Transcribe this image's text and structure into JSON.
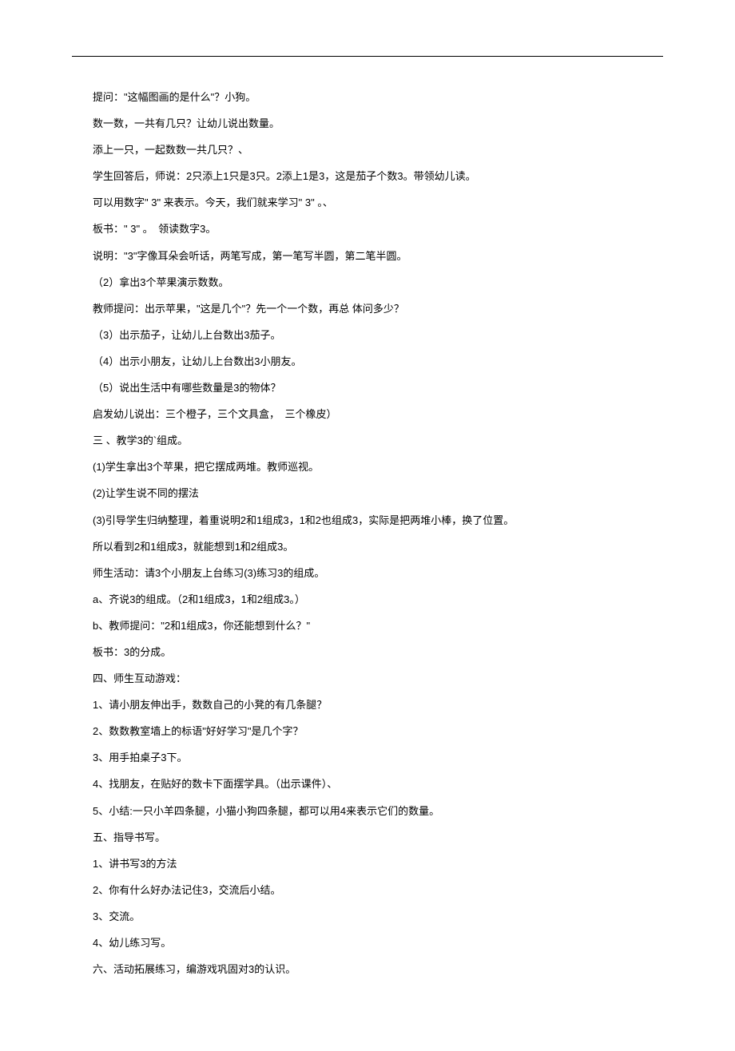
{
  "lines": [
    "提问：\"这幅图画的是什么\"？小狗。",
    "数一数，一共有几只？让幼儿说出数量。",
    "添上一只，一起数数一共几只？、",
    "学生回答后，师说：2只添上1只是3只。2添上1是3，这是茄子个数3。带领幼儿读。",
    "可以用数字\" 3\" 来表示。今天，我们就来学习\" 3\" 。、",
    "板书：\" 3\" 。　领读数字3。",
    "说明：\"3\"字像耳朵会听话，两笔写成，第一笔写半圆，第二笔半圆。",
    "（2）拿出3个苹果演示数数。",
    "教师提问：出示苹果，\"这是几个\"？先一个一个数，再总 体问多少？",
    "（3）出示茄子，让幼儿上台数出3茄子。",
    "（4）出示小朋友，让幼儿上台数出3小朋友。",
    "（5）说出生活中有哪些数量是3的物体？",
    "启发幼儿说出：三个橙子，三个文具盒，　三个橡皮）",
    "三 、教学3的`组成。",
    "(1)学生拿出3个苹果，把它摆成两堆。教师巡视。",
    "(2)让学生说不同的摆法",
    "(3)引导学生归纳整理，着重说明2和1组成3，1和2也组成3，实际是把两堆小棒，换了位置。",
    "所以看到2和1组成3，就能想到1和2组成3。",
    "师生活动：请3个小朋友上台练习(3)练习3的组成。",
    "a、齐说3的组成。（2和1组成3，1和2组成3。）",
    "b、教师提问：\"2和1组成3，你还能想到什么？\"",
    "板书：3的分成。",
    "四、师生互动游戏：",
    "1、请小朋友伸出手，数数自己的小凳的有几条腿？",
    "2、数数教室墙上的标语\"好好学习\"是几个字？",
    "3、用手拍桌子3下。",
    "4、找朋友，在贴好的数卡下面摆学具。（出示课件）、",
    "5、小结:一只小羊四条腿，小猫小狗四条腿，都可以用4来表示它们的数量。",
    "五、指导书写。",
    "1、讲书写3的方法",
    "2、你有什么好办法记住3，交流后小结。",
    "3、交流。",
    "4、幼儿练习写。",
    "六、活动拓展练习，编游戏巩固对3的认识。"
  ]
}
